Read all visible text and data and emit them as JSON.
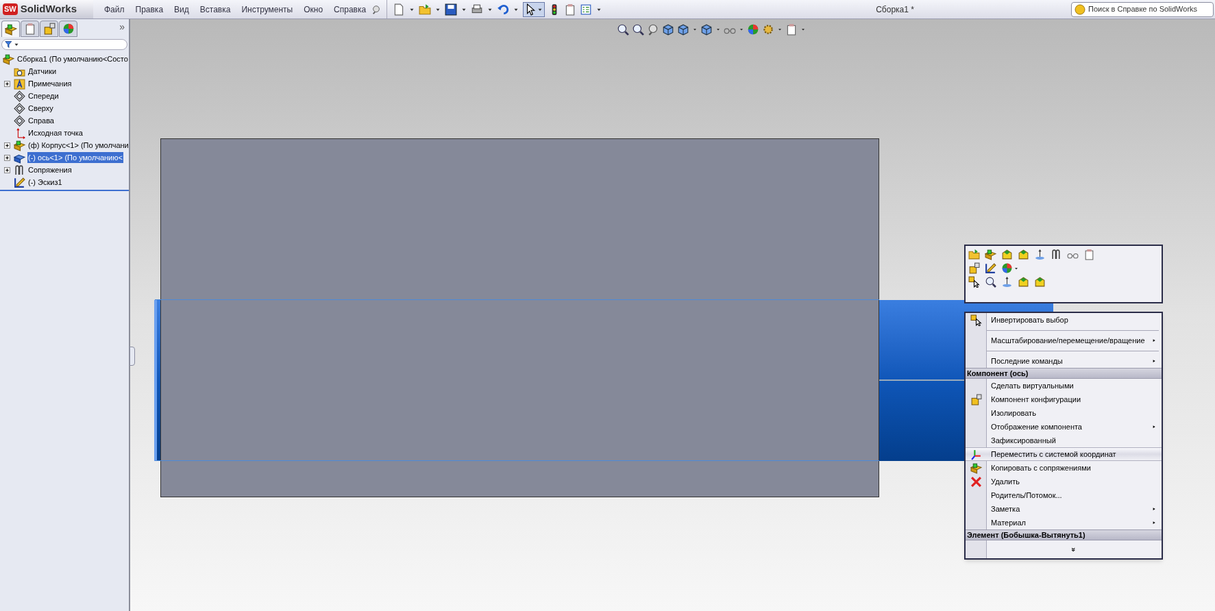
{
  "app": {
    "logo_badge": "SW",
    "logo_text": "SolidWorks",
    "title": "Сборка1 *"
  },
  "menu_bar": [
    "Файл",
    "Правка",
    "Вид",
    "Вставка",
    "Инструменты",
    "Окно",
    "Справка"
  ],
  "help_search": {
    "placeholder": "Поиск в Справке по SolidWorks"
  },
  "panel_tabs": [
    {
      "selected": true
    },
    {
      "selected": false
    },
    {
      "selected": false
    },
    {
      "selected": false
    }
  ],
  "panel_more": "»",
  "tree": {
    "label": "Сборка1  (По умолчанию<Состо",
    "selected": false,
    "expandable": false,
    "children": [
      {
        "label": "Датчики",
        "selected": false,
        "expandable": false
      },
      {
        "label": "Примечания",
        "selected": false,
        "expandable": true
      },
      {
        "label": "Спереди",
        "selected": false,
        "expandable": false
      },
      {
        "label": "Сверху",
        "selected": false,
        "expandable": false
      },
      {
        "label": "Справа",
        "selected": false,
        "expandable": false
      },
      {
        "label": "Исходная точка",
        "selected": false,
        "expandable": false
      },
      {
        "label": "(ф) Корпус<1> (По умолчани",
        "selected": false,
        "expandable": true
      },
      {
        "label": "(-) ось<1> (По умолчанию<",
        "selected": true,
        "expandable": true
      },
      {
        "label": "Сопряжения",
        "selected": false,
        "expandable": true
      },
      {
        "label": "(-) Эскиз1",
        "selected": false,
        "expandable": false
      }
    ]
  },
  "context_menu": [
    {
      "kind": "command",
      "label": "Инвертировать выбор",
      "submenu": false,
      "selected": false
    },
    {
      "kind": "separator"
    },
    {
      "kind": "command",
      "label": "Масштабирование/перемещение/вращение",
      "submenu": true,
      "selected": false
    },
    {
      "kind": "separator"
    },
    {
      "kind": "command",
      "label": "Последние команды",
      "submenu": true,
      "selected": false
    },
    {
      "kind": "header",
      "label": "Компонент (ось)"
    },
    {
      "kind": "command",
      "label": "Сделать виртуальными",
      "submenu": false,
      "selected": false
    },
    {
      "kind": "command",
      "label": "Компонент конфигурации",
      "submenu": false,
      "selected": false
    },
    {
      "kind": "command",
      "label": "Изолировать",
      "submenu": false,
      "selected": false
    },
    {
      "kind": "command",
      "label": "Отображение компонента",
      "submenu": true,
      "selected": false
    },
    {
      "kind": "command",
      "label": "Зафиксированный",
      "submenu": false,
      "selected": false
    },
    {
      "kind": "command",
      "label": "Переместить с системой координат",
      "submenu": false,
      "selected": true
    },
    {
      "kind": "command",
      "label": "Копировать с сопряжениями",
      "submenu": false,
      "selected": false
    },
    {
      "kind": "command",
      "label": "Удалить",
      "submenu": false,
      "selected": false
    },
    {
      "kind": "command",
      "label": "Родитель/Потомок...",
      "submenu": false,
      "selected": false
    },
    {
      "kind": "command",
      "label": "Заметка",
      "submenu": true,
      "selected": false
    },
    {
      "kind": "command",
      "label": "Материал",
      "submenu": true,
      "selected": false
    },
    {
      "kind": "header",
      "label": "Элемент (Бобышка-Вытянуть1)"
    },
    {
      "kind": "more",
      "label": "»"
    }
  ]
}
